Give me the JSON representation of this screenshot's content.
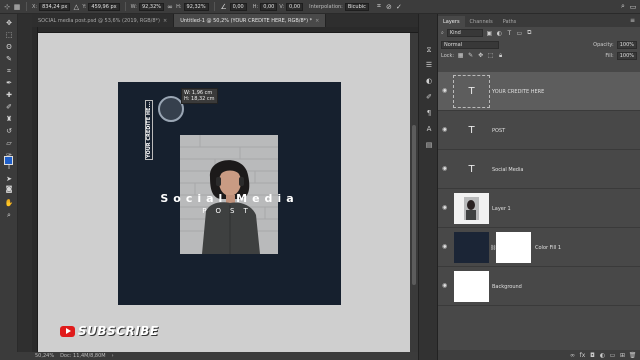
{
  "options": {
    "x_label": "X:",
    "x_value": "834,24 px",
    "y_label": "Y:",
    "y_value": "459,96 px",
    "w_label": "W:",
    "w_value": "92,32%",
    "h_label": "H:",
    "h_value": "92,32%",
    "angle_value": "0,00",
    "h_skew_label": "H:",
    "h_skew_value": "0,00",
    "v_skew_label": "V:",
    "v_skew_value": "0,00",
    "interp_label": "Interpolation:",
    "interp_value": "Bicubic"
  },
  "doc_tabs": [
    {
      "label": "SOCIAL media post.psd @ 53,6% (2019, RGB/8*)",
      "close": "×"
    },
    {
      "label": "Untitled-1 @ 50,2% (YOUR CREDITE HERE, RGB/8*) *",
      "close": "×"
    }
  ],
  "canvas": {
    "credit_text": "YOUR CREDITE HE...",
    "title_text": "Social Media",
    "post_text": "POST",
    "measure_w": "W: 1,96 cm",
    "measure_h": "H: 18,32 cm",
    "artboard_color": "#16202e"
  },
  "subscribe": {
    "label": "SUBSCRIBE",
    "logo_color": "#e01b1b"
  },
  "status": {
    "zoom": "50,24%",
    "doc": "Doc: 11,4M/8,80M"
  },
  "colors": {
    "foreground": "#1f5fc9",
    "background": "#111111"
  },
  "panel": {
    "tabs": [
      "Layers",
      "Channels",
      "Paths"
    ],
    "filter_value": "Kind",
    "blend_mode": "Normal",
    "opacity_label": "Opacity:",
    "opacity_value": "100%",
    "lock_label": "Lock:",
    "fill_label": "Fill:",
    "fill_value": "100%"
  },
  "layers": [
    {
      "name": "YOUR CREDITE HERE",
      "kind": "text",
      "selected": true
    },
    {
      "name": "POST",
      "kind": "text"
    },
    {
      "name": "Social Media",
      "kind": "text"
    },
    {
      "name": "Layer 1",
      "kind": "image"
    },
    {
      "name": "Color Fill 1",
      "kind": "fill"
    },
    {
      "name": "Background",
      "kind": "background"
    }
  ],
  "icons": {
    "tools": [
      "move-tool-icon",
      "marquee-tool-icon",
      "lasso-tool-icon",
      "quick-select-icon",
      "crop-tool-icon",
      "eyedropper-icon",
      "healing-brush-icon",
      "brush-tool-icon",
      "clone-stamp-icon",
      "history-brush-icon",
      "eraser-icon",
      "gradient-icon",
      "blur-icon",
      "dodge-icon",
      "pen-tool-icon",
      "type-tool-icon",
      "path-select-icon",
      "shape-tool-icon",
      "hand-tool-icon",
      "zoom-tool-icon"
    ]
  }
}
